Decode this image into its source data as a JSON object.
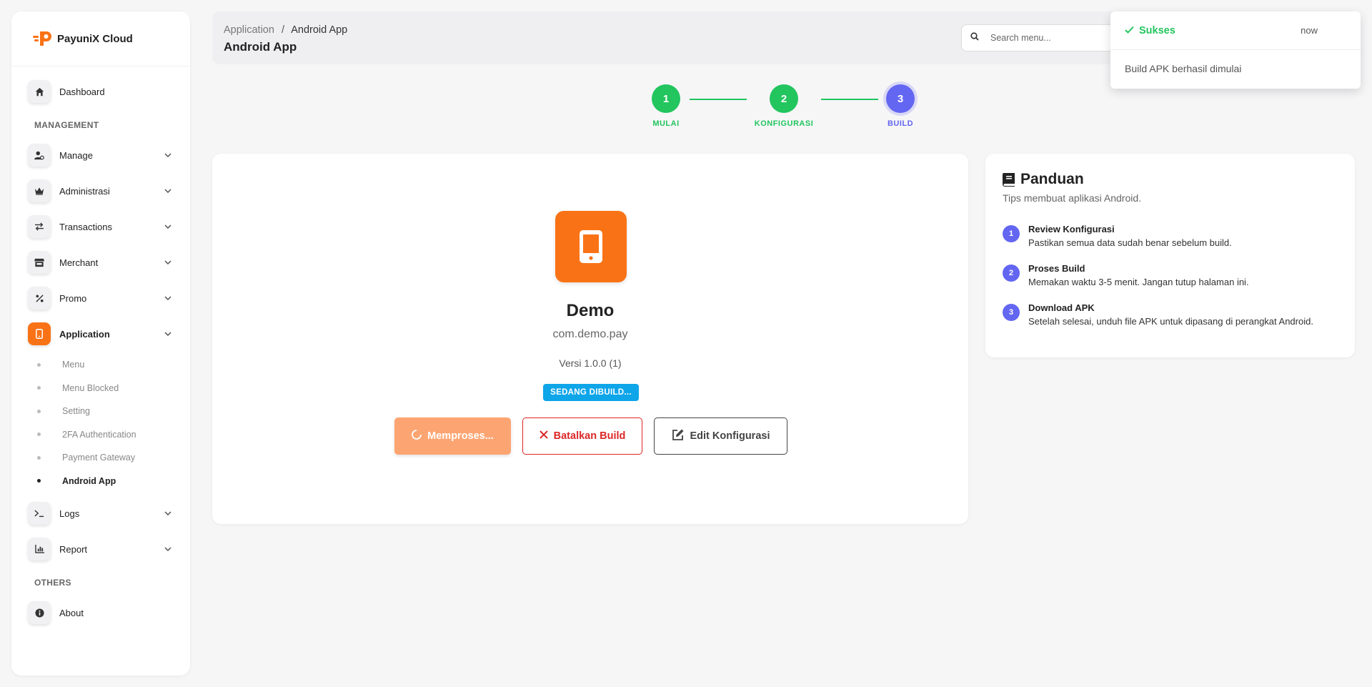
{
  "brand": {
    "name": "PayuniX Cloud"
  },
  "sidebar": {
    "top_items": [
      {
        "label": "Dashboard",
        "icon": "home-icon"
      }
    ],
    "section_management": "MANAGEMENT",
    "management_items": [
      {
        "label": "Manage",
        "icon": "user-gear-icon"
      },
      {
        "label": "Administrasi",
        "icon": "crown-icon"
      },
      {
        "label": "Transactions",
        "icon": "arrows-exchange-icon"
      },
      {
        "label": "Merchant",
        "icon": "store-icon"
      },
      {
        "label": "Promo",
        "icon": "percent-icon"
      },
      {
        "label": "Application",
        "icon": "mobile-icon",
        "active": true
      }
    ],
    "application_sub": [
      {
        "label": "Menu"
      },
      {
        "label": "Menu Blocked"
      },
      {
        "label": "Setting"
      },
      {
        "label": "2FA Authentication"
      },
      {
        "label": "Payment Gateway"
      },
      {
        "label": "Android App",
        "active": true
      }
    ],
    "after_items": [
      {
        "label": "Logs",
        "icon": "terminal-icon"
      },
      {
        "label": "Report",
        "icon": "chart-icon"
      }
    ],
    "section_others": "OTHERS",
    "other_items": [
      {
        "label": "About",
        "icon": "info-icon"
      }
    ]
  },
  "header": {
    "breadcrumb_parent": "Application",
    "breadcrumb_sep": "/",
    "breadcrumb_current": "Android App",
    "title": "Android App",
    "search_placeholder": "Search menu..."
  },
  "stepper": {
    "steps": [
      {
        "num": "1",
        "label": "MULAI",
        "state": "done"
      },
      {
        "num": "2",
        "label": "KONFIGURASI",
        "state": "done"
      },
      {
        "num": "3",
        "label": "BUILD",
        "state": "active"
      }
    ]
  },
  "app": {
    "name": "Demo",
    "package": "com.demo.pay",
    "version": "Versi 1.0.0 (1)",
    "status": "SEDANG DIBUILD...",
    "btn_process": "Memproses...",
    "btn_cancel": "Batalkan Build",
    "btn_edit": "Edit Konfigurasi"
  },
  "guide": {
    "title": "Panduan",
    "subtitle": "Tips membuat aplikasi Android.",
    "tips": [
      {
        "num": "1",
        "title": "Review Konfigurasi",
        "desc": "Pastikan semua data sudah benar sebelum build."
      },
      {
        "num": "2",
        "title": "Proses Build",
        "desc": "Memakan waktu 3-5 menit. Jangan tutup halaman ini."
      },
      {
        "num": "3",
        "title": "Download APK",
        "desc": "Setelah selesai, unduh file APK untuk dipasang di perangkat Android."
      }
    ]
  },
  "toast": {
    "title": "Sukses",
    "time": "now",
    "message": "Build APK berhasil dimulai"
  },
  "colors": {
    "accent": "#f97316",
    "success": "#22c55e",
    "step_active": "#6366f1",
    "info": "#0ea5e9",
    "danger": "#dc2626"
  }
}
